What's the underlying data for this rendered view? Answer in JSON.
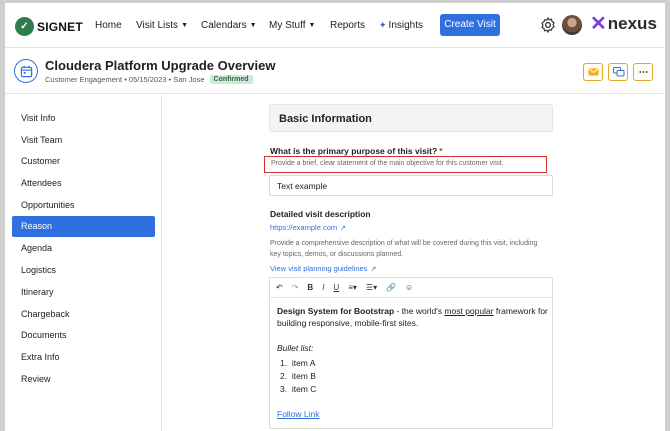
{
  "app": {
    "logo_text": "SIGNET",
    "brand_text": "nexus"
  },
  "nav": {
    "items": [
      {
        "label": "Home",
        "has_caret": false
      },
      {
        "label": "Visit Lists",
        "has_caret": true
      },
      {
        "label": "Calendars",
        "has_caret": true
      },
      {
        "label": "My Stuff",
        "has_caret": true
      },
      {
        "label": "Reports",
        "has_caret": false
      },
      {
        "label": "Insights",
        "has_caret": false,
        "icon": "sparkle-icon"
      }
    ],
    "create_button": "Create Visit"
  },
  "visit": {
    "title": "Cloudera Platform Upgrade Overview",
    "meta": "Customer Engagement • 05/15/2023 • San Jose",
    "status": "Confirmed"
  },
  "header_actions": [
    "email-icon",
    "chat-icon",
    "more-icon"
  ],
  "sidebar": {
    "items": [
      {
        "label": "Visit Info"
      },
      {
        "label": "Visit Team"
      },
      {
        "label": "Customer"
      },
      {
        "label": "Attendees"
      },
      {
        "label": "Opportunities"
      },
      {
        "label": "Reason",
        "active": true
      },
      {
        "label": "Agenda"
      },
      {
        "label": "Logistics"
      },
      {
        "label": "Itinerary"
      },
      {
        "label": "Chargeback"
      },
      {
        "label": "Documents"
      },
      {
        "label": "Extra Info"
      },
      {
        "label": "Review"
      }
    ]
  },
  "form": {
    "section_title": "Basic Information",
    "purpose_label": "What is the primary purpose of this visit?",
    "required_mark": "*",
    "purpose_hint": "Provide a brief, clear statement of the main objective for this customer visit.",
    "purpose_value": "Text example",
    "description_label": "Detailed visit description",
    "example_link": "https://example.com",
    "description_help": "Provide a comprehensive description of what will be covered during this visit, including key topics, demos, or discussions planned.",
    "guidelines_link": "View visit planning guidelines",
    "editor": {
      "toolbar": [
        "↶",
        "↷",
        "B",
        "I",
        "U",
        "≡▾",
        "☰▾",
        "🔗",
        "☺"
      ],
      "bold_lead": "Design System for Bootstrap",
      "text_1": " - the world's ",
      "underlined": "most popular",
      "text_2": " framework for building responsive, mobile-first sites.",
      "bullet_title": "Bullet list:",
      "list_items": [
        "item A",
        "item B",
        "item C"
      ],
      "follow_link": "Follow Link"
    }
  },
  "colors": {
    "primary": "#2f6fe0",
    "logo_green": "#2e7d4f",
    "brand_purple": "#7b3fe4",
    "highlight_red": "#d32f2f",
    "badge_green": "#cfe9d8",
    "action_amber": "#e0a92a"
  }
}
